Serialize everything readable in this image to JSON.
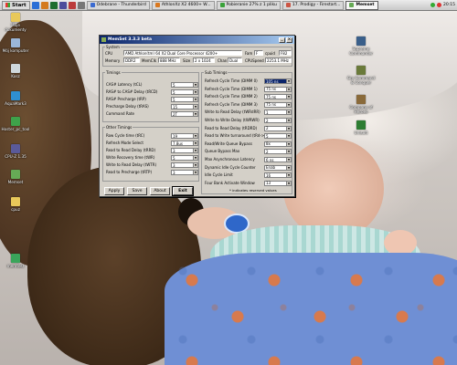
{
  "taskbar": {
    "start_label": "Start",
    "tasks": [
      {
        "label": "Odebrane - Thunderbird"
      },
      {
        "label": "AthlonXz X2 4600+ W..."
      },
      {
        "label": "Pobieranie 27% z 1 pliku"
      },
      {
        "label": "17. Prodigy - Firestart..."
      },
      {
        "label": "Memset"
      }
    ],
    "clock": "20:15"
  },
  "desktop_icons_left": [
    {
      "label": "Moje dokumenty"
    },
    {
      "label": "Mój komputer"
    },
    {
      "label": "Kosz"
    },
    {
      "label": "AquaMark3"
    },
    {
      "label": "Hoster_pc_tool"
    },
    {
      "label": "CPU-Z 1.35"
    },
    {
      "label": "Memset"
    },
    {
      "label": "cpuz"
    },
    {
      "label": "memtest"
    }
  ],
  "desktop_icons_right": [
    {
      "label": "Supreme Commander"
    },
    {
      "label": "Gry Command & Conquer"
    },
    {
      "label": "Company of Heroes"
    },
    {
      "label": "Unisoft"
    }
  ],
  "window": {
    "title": "MemSet 3.3.3 beta",
    "system": {
      "group_label": "System",
      "cpu_label": "CPU",
      "cpu_value": "AMD Athlon(tm) 64 X2 Dual Core Processor 4200+",
      "fam_label": "Fam",
      "fam_value": "F",
      "cpuid_label": "cpuid",
      "cpuid_value": "F82",
      "memory_label": "Memory",
      "memory_value": "DDR2",
      "memclk_label": "MemClk",
      "memclk_value": "888 MHz",
      "size_label": "Size",
      "size_value": "2 x 1024",
      "chan_label": "Chan",
      "chan_value": "Dual",
      "cpuspeed_label": "CPUSpeed",
      "cpuspeed_value": "2253.1 MHz"
    },
    "timings": {
      "group_label": "Timings",
      "rows": [
        {
          "label": "CAS# Latency (tCL)",
          "value": "5"
        },
        {
          "label": "RAS# to CAS# Delay (tRCD)",
          "value": "5"
        },
        {
          "label": "RAS# Precharge (tRP)",
          "value": "5"
        },
        {
          "label": "Precharge Delay (tRAS)",
          "value": "15"
        },
        {
          "label": "Command Rate",
          "value": "2T"
        }
      ]
    },
    "other_timings": {
      "group_label": "Other Timings",
      "rows": [
        {
          "label": "Row Cycle time (tRC)",
          "value": "19"
        },
        {
          "label": "Refresh Mode Select",
          "value": "7.8us"
        },
        {
          "label": "Read to Read Delay (tRRD)",
          "value": "3"
        },
        {
          "label": "Write Recovery time (tWR)",
          "value": "5"
        },
        {
          "label": "Write to Read Delay (tWTR)",
          "value": "3"
        },
        {
          "label": "Read to Precharge (tRTP)",
          "value": "3"
        }
      ]
    },
    "sub_timings": {
      "group_label": "Sub Timings",
      "rows": [
        {
          "label": "Refresh Cycle Time (DIMM 0)",
          "value": "105 ns",
          "selected": true
        },
        {
          "label": "Refresh Cycle Time (DIMM 1)",
          "value": "75 ns"
        },
        {
          "label": "Refresh Cycle Time (DIMM 2)",
          "value": "75 ns"
        },
        {
          "label": "Refresh Cycle Time (DIMM 3)",
          "value": "75 ns"
        },
        {
          "label": "Write to Read Delay (tWRdRR)",
          "value": "1"
        },
        {
          "label": "Write to Write Delay (tWRWR)",
          "value": "2"
        },
        {
          "label": "Read to Read Delay (tRDRD)",
          "value": "2"
        },
        {
          "label": "Read to Write turnaround (tRd->Wr)",
          "value": "5"
        },
        {
          "label": "Read/Write Queue Bypass",
          "value": "8x"
        },
        {
          "label": "Queue Bypass Max",
          "value": "2"
        },
        {
          "label": "Max Asynchronous Latency",
          "value": "6 ns"
        },
        {
          "label": "Dynamic Idle Cycle Counter",
          "value": "Enab"
        },
        {
          "label": "Idle Cycle Limit",
          "value": "16"
        },
        {
          "label": "Four Bank Activate Window",
          "value": "13"
        }
      ],
      "note": "* indicates reserved values"
    },
    "buttons": {
      "apply": "Apply",
      "save": "Save",
      "about": "About",
      "exit": "Exit"
    }
  }
}
